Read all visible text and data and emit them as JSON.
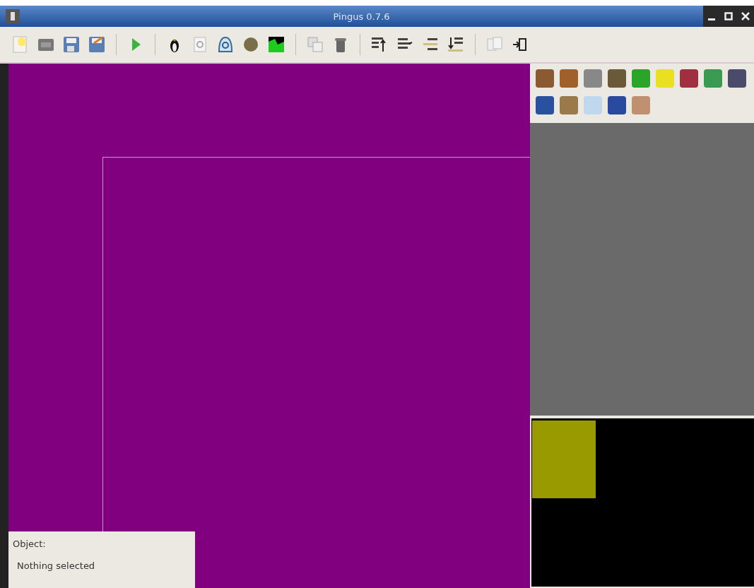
{
  "window": {
    "title": "Pingus 0.7.6"
  },
  "object_panel": {
    "label": "Object:",
    "value": "Nothing selected"
  }
}
